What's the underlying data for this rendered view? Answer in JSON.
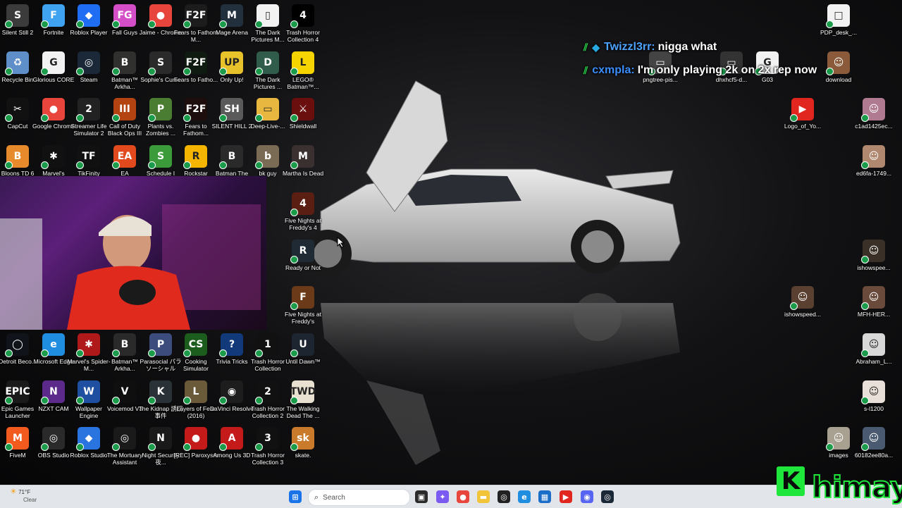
{
  "desktop": {
    "icons": [
      {
        "label": "Silent Still 2",
        "color": "#3b3b3b",
        "glyph": "S"
      },
      {
        "label": "Fortnite",
        "color": "#3fa3f2",
        "glyph": "F"
      },
      {
        "label": "Roblox Player",
        "color": "#1f6df2",
        "glyph": "◆"
      },
      {
        "label": "Fall Guys",
        "color": "#d44fc7",
        "glyph": "FG"
      },
      {
        "label": "Jaime - Chrome",
        "color": "#e8453c",
        "glyph": "●"
      },
      {
        "label": "Fears to Fathom M...",
        "color": "#1c1c1c",
        "glyph": "F2F"
      },
      {
        "label": "Mage Arena",
        "color": "#22303d",
        "glyph": "M"
      },
      {
        "label": "The Dark Pictures M...",
        "color": "#f2f2f2",
        "glyph": "▯"
      },
      {
        "label": "Trash Horror Collection 4",
        "color": "#000000",
        "glyph": "4"
      },
      {
        "label": "Recycle Bin",
        "color": "#5e8fc8",
        "glyph": "♻"
      },
      {
        "label": "Glorious CORE",
        "color": "#f2f2f2",
        "glyph": "G"
      },
      {
        "label": "Steam",
        "color": "#1b2838",
        "glyph": "◎"
      },
      {
        "label": "Batman™ Arkha...",
        "color": "#30302e",
        "glyph": "B"
      },
      {
        "label": "Sophie's Curse",
        "color": "#2a2a2a",
        "glyph": "S"
      },
      {
        "label": "Fears to Fatho...",
        "color": "#0f1a10",
        "glyph": "F2F"
      },
      {
        "label": "Only Up!",
        "color": "#e7c22b",
        "glyph": "UP"
      },
      {
        "label": "The Dark Pictures ...",
        "color": "#2f5c4b",
        "glyph": "D"
      },
      {
        "label": "LEGO® Batman™...",
        "color": "#f5d400",
        "glyph": "L"
      },
      {
        "label": "CapCut",
        "color": "#111111",
        "glyph": "✂"
      },
      {
        "label": "Google Chrome",
        "color": "#e8453c",
        "glyph": "●"
      },
      {
        "label": "Streamer Life Simulator 2",
        "color": "#222222",
        "glyph": "2"
      },
      {
        "label": "Call of Duty Black Ops III",
        "color": "#b34412",
        "glyph": "III"
      },
      {
        "label": "Plants vs. Zombies ...",
        "color": "#4a7d32",
        "glyph": "P"
      },
      {
        "label": "Fears to Fathom...",
        "color": "#1e0d0d",
        "glyph": "F2F"
      },
      {
        "label": "SILENT HILL 2",
        "color": "#5a5a5a",
        "glyph": "SH"
      },
      {
        "label": "Deep-Live-...",
        "color": "#e8b740",
        "glyph": "▭"
      },
      {
        "label": "Shieldwall",
        "color": "#6a0e0e",
        "glyph": "⚔"
      },
      {
        "label": "Bloons TD 6",
        "color": "#e78a2b",
        "glyph": "B"
      },
      {
        "label": "Marvel's",
        "color": "#111111",
        "glyph": "✱"
      },
      {
        "label": "TikFinity",
        "color": "#111111",
        "glyph": "TF"
      },
      {
        "label": "EA",
        "color": "#e24a1e",
        "glyph": "EA"
      },
      {
        "label": "Schedule I",
        "color": "#3b9b3b",
        "glyph": "S"
      },
      {
        "label": "Rockstar",
        "color": "#f5b400",
        "glyph": "R"
      },
      {
        "label": "Batman The",
        "color": "#2a2a2a",
        "glyph": "B"
      },
      {
        "label": "bk guy",
        "color": "#7a6b55",
        "glyph": "b"
      },
      {
        "label": "Martha Is Dead",
        "color": "#3a3030",
        "glyph": "M"
      },
      {
        "label": "Five Nights at Freddy's 4",
        "color": "#5a1e12",
        "glyph": "4"
      },
      {
        "label": "Ready or Not",
        "color": "#1f2a35",
        "glyph": "R"
      },
      {
        "label": "Five Nights at Freddy's",
        "color": "#6b3a18",
        "glyph": "F"
      },
      {
        "label": "Detroit Beco...",
        "color": "#10131a",
        "glyph": "◯"
      },
      {
        "label": "Microsoft Edge",
        "color": "#1f8de0",
        "glyph": "e"
      },
      {
        "label": "Marvel's Spider-M...",
        "color": "#b01919",
        "glyph": "✱"
      },
      {
        "label": "Batman™ Arkha...",
        "color": "#2a2a2a",
        "glyph": "B"
      },
      {
        "label": "Parasocial パラソーシャル",
        "color": "#3c4c7d",
        "glyph": "P"
      },
      {
        "label": "Cooking Simulator",
        "color": "#1c5c1c",
        "glyph": "CS"
      },
      {
        "label": "Trivia Tricks",
        "color": "#123a7a",
        "glyph": "?"
      },
      {
        "label": "Trash Horror Collection",
        "color": "#111111",
        "glyph": "1"
      },
      {
        "label": "Until Dawn™",
        "color": "#1c2530",
        "glyph": "U"
      },
      {
        "label": "Epic Games Launcher",
        "color": "#1a1a1a",
        "glyph": "EPIC"
      },
      {
        "label": "NZXT CAM",
        "color": "#5b2a8a",
        "glyph": "N"
      },
      {
        "label": "Wallpaper Engine",
        "color": "#1e4fa0",
        "glyph": "W"
      },
      {
        "label": "Voicemod V3",
        "color": "#0f0f0f",
        "glyph": "V"
      },
      {
        "label": "The Kidnap 誘拐事件",
        "color": "#2a3238",
        "glyph": "K"
      },
      {
        "label": "Layers of Fear (2016)",
        "color": "#6a5a3a",
        "glyph": "L"
      },
      {
        "label": "DaVinci Resolve",
        "color": "#1d1d1d",
        "glyph": "◉"
      },
      {
        "label": "Trash Horror Collection 2",
        "color": "#111111",
        "glyph": "2"
      },
      {
        "label": "The Walking Dead The ...",
        "color": "#e8e0d0",
        "glyph": "TWD"
      },
      {
        "label": "FiveM",
        "color": "#f25a1e",
        "glyph": "M"
      },
      {
        "label": "OBS Studio",
        "color": "#2a2a2a",
        "glyph": "◎"
      },
      {
        "label": "Roblox Studio",
        "color": "#2a74e0",
        "glyph": "◆"
      },
      {
        "label": "The Mortuary Assistant",
        "color": "#1a1a1a",
        "glyph": "◎"
      },
      {
        "label": "Night Security 夜...",
        "color": "#1a1a1a",
        "glyph": "N"
      },
      {
        "label": "[REC] Paroxysm",
        "color": "#c41a1a",
        "glyph": "●"
      },
      {
        "label": "Among Us 3D",
        "color": "#c41a1a",
        "glyph": "A"
      },
      {
        "label": "Trash Horror Collection 3",
        "color": "#111111",
        "glyph": "3"
      },
      {
        "label": "skate.",
        "color": "#c97a2b",
        "glyph": "sk"
      }
    ],
    "right_icons": [
      {
        "label": "PDP_desk_...",
        "color": "#f2f2f2",
        "glyph": "□"
      },
      {
        "label": "pngtree-pis...",
        "color": "#444444",
        "glyph": "▭"
      },
      {
        "label": "dhxhcf5-d...",
        "color": "#333333",
        "glyph": "▭"
      },
      {
        "label": "G03",
        "color": "#f2f2f2",
        "glyph": "G"
      },
      {
        "label": "download",
        "color": "#8a5a3a",
        "glyph": "☺"
      },
      {
        "label": "Logo_of_Yo...",
        "color": "#e0261e",
        "glyph": "▶"
      },
      {
        "label": "c1ad1425ec...",
        "color": "#b07a90",
        "glyph": "☺"
      },
      {
        "label": "ed6fa-1749...",
        "color": "#b08870",
        "glyph": "☺"
      },
      {
        "label": "ishowspee...",
        "color": "#3a3028",
        "glyph": "☺"
      },
      {
        "label": "ishowspeed...",
        "color": "#5a4030",
        "glyph": "☺"
      },
      {
        "label": "MFH-HER...",
        "color": "#6a4a3a",
        "glyph": "☺"
      },
      {
        "label": "Abraham_L...",
        "color": "#d8d8d8",
        "glyph": "☺"
      },
      {
        "label": "s-l1200",
        "color": "#e8e0d8",
        "glyph": "☺"
      },
      {
        "label": "images",
        "color": "#a8a090",
        "glyph": "☺"
      },
      {
        "label": "60182ee80a...",
        "color": "#4a5a70",
        "glyph": "☺"
      }
    ]
  },
  "chat": {
    "messages": [
      {
        "user": "Twizzl3rr:",
        "text": "nigga what"
      },
      {
        "user": "cxmpla:",
        "text": "I'm only playing 2k on 2x rep now"
      }
    ]
  },
  "taskbar": {
    "weather_temp": "71°F",
    "weather_desc": "Clear",
    "search_placeholder": "Search",
    "icons": [
      {
        "name": "start-icon",
        "color": "#1a73e8",
        "glyph": "⊞"
      },
      {
        "name": "search-icon",
        "color": "#ffffff",
        "glyph": ""
      },
      {
        "name": "taskview-icon",
        "color": "#2a2a2a",
        "glyph": "▣"
      },
      {
        "name": "copilot-icon",
        "color": "#7a5af0",
        "glyph": "✦"
      },
      {
        "name": "chrome-icon",
        "color": "#e8453c",
        "glyph": "●"
      },
      {
        "name": "file-explorer-icon",
        "color": "#f2c43a",
        "glyph": "▬"
      },
      {
        "name": "obs-icon",
        "color": "#222222",
        "glyph": "◎"
      },
      {
        "name": "edge-icon",
        "color": "#1f8de0",
        "glyph": "e"
      },
      {
        "name": "store-icon",
        "color": "#1a6ec8",
        "glyph": "▦"
      },
      {
        "name": "youtube-icon",
        "color": "#e0261e",
        "glyph": "▶"
      },
      {
        "name": "discord-icon",
        "color": "#5865f2",
        "glyph": "◉"
      },
      {
        "name": "steam-icon",
        "color": "#1b2838",
        "glyph": "◎"
      }
    ]
  },
  "overlay_logo": {
    "k_glyph": "K",
    "word": "himay"
  }
}
